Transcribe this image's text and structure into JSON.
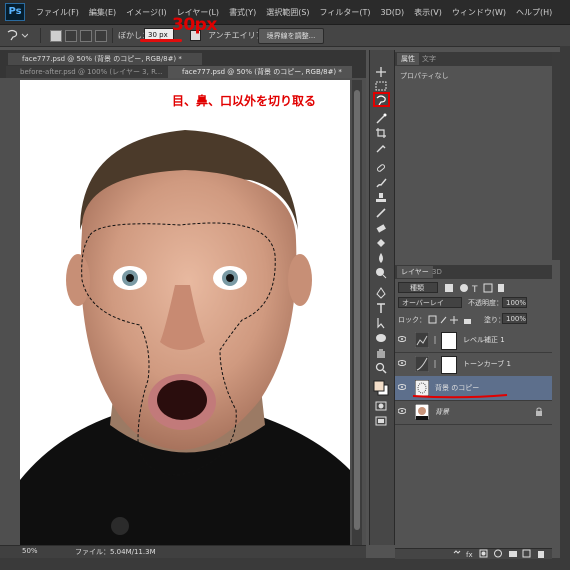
{
  "app": {
    "logo": "Ps"
  },
  "menu": [
    "ファイル(F)",
    "編集(E)",
    "イメージ(I)",
    "レイヤー(L)",
    "書式(Y)",
    "選択範囲(S)",
    "フィルター(T)",
    "3D(D)",
    "表示(V)",
    "ウィンドウ(W)",
    "ヘルプ(H)"
  ],
  "options": {
    "feather_label": "ぼかし：",
    "feather_value": "30 px",
    "antialias_label": "アンチエイリアス",
    "refine_edge_label": "境界線を調整..."
  },
  "annotations": {
    "feather_note": "30px",
    "cut_note": "目、鼻、口以外を切り取る",
    "color": "#e10000"
  },
  "doc_tabs": [
    "face777.psd @ 50% (背景 のコピー, RGB/8#) *",
    "before-after.psd @ 100% (レイヤー 3, R...",
    "face777.psd @ 50% (背景 のコピー, RGB/8#) *"
  ],
  "status": {
    "zoom": "50%",
    "file_info": "ファイル：5.04M/11.3M"
  },
  "properties_panel": {
    "tabs": [
      "属性",
      "文字"
    ],
    "content": "プロパティなし"
  },
  "layers_panel": {
    "tabs": [
      "レイヤー",
      "3D"
    ],
    "filter_kind": "種類",
    "blend_mode": "オーバーレイ",
    "opacity_label": "不透明度：",
    "opacity_value": "100%",
    "lock_label": "ロック：",
    "fill_label": "塗り：",
    "fill_value": "100%",
    "layers": [
      {
        "name": "レベル補正 1"
      },
      {
        "name": "トーンカーブ 1"
      },
      {
        "name": "背景 のコピー"
      },
      {
        "name": "背景"
      }
    ]
  },
  "colors": {
    "selected_layer": "#5d6f8c",
    "accent_red": "#e10000"
  }
}
